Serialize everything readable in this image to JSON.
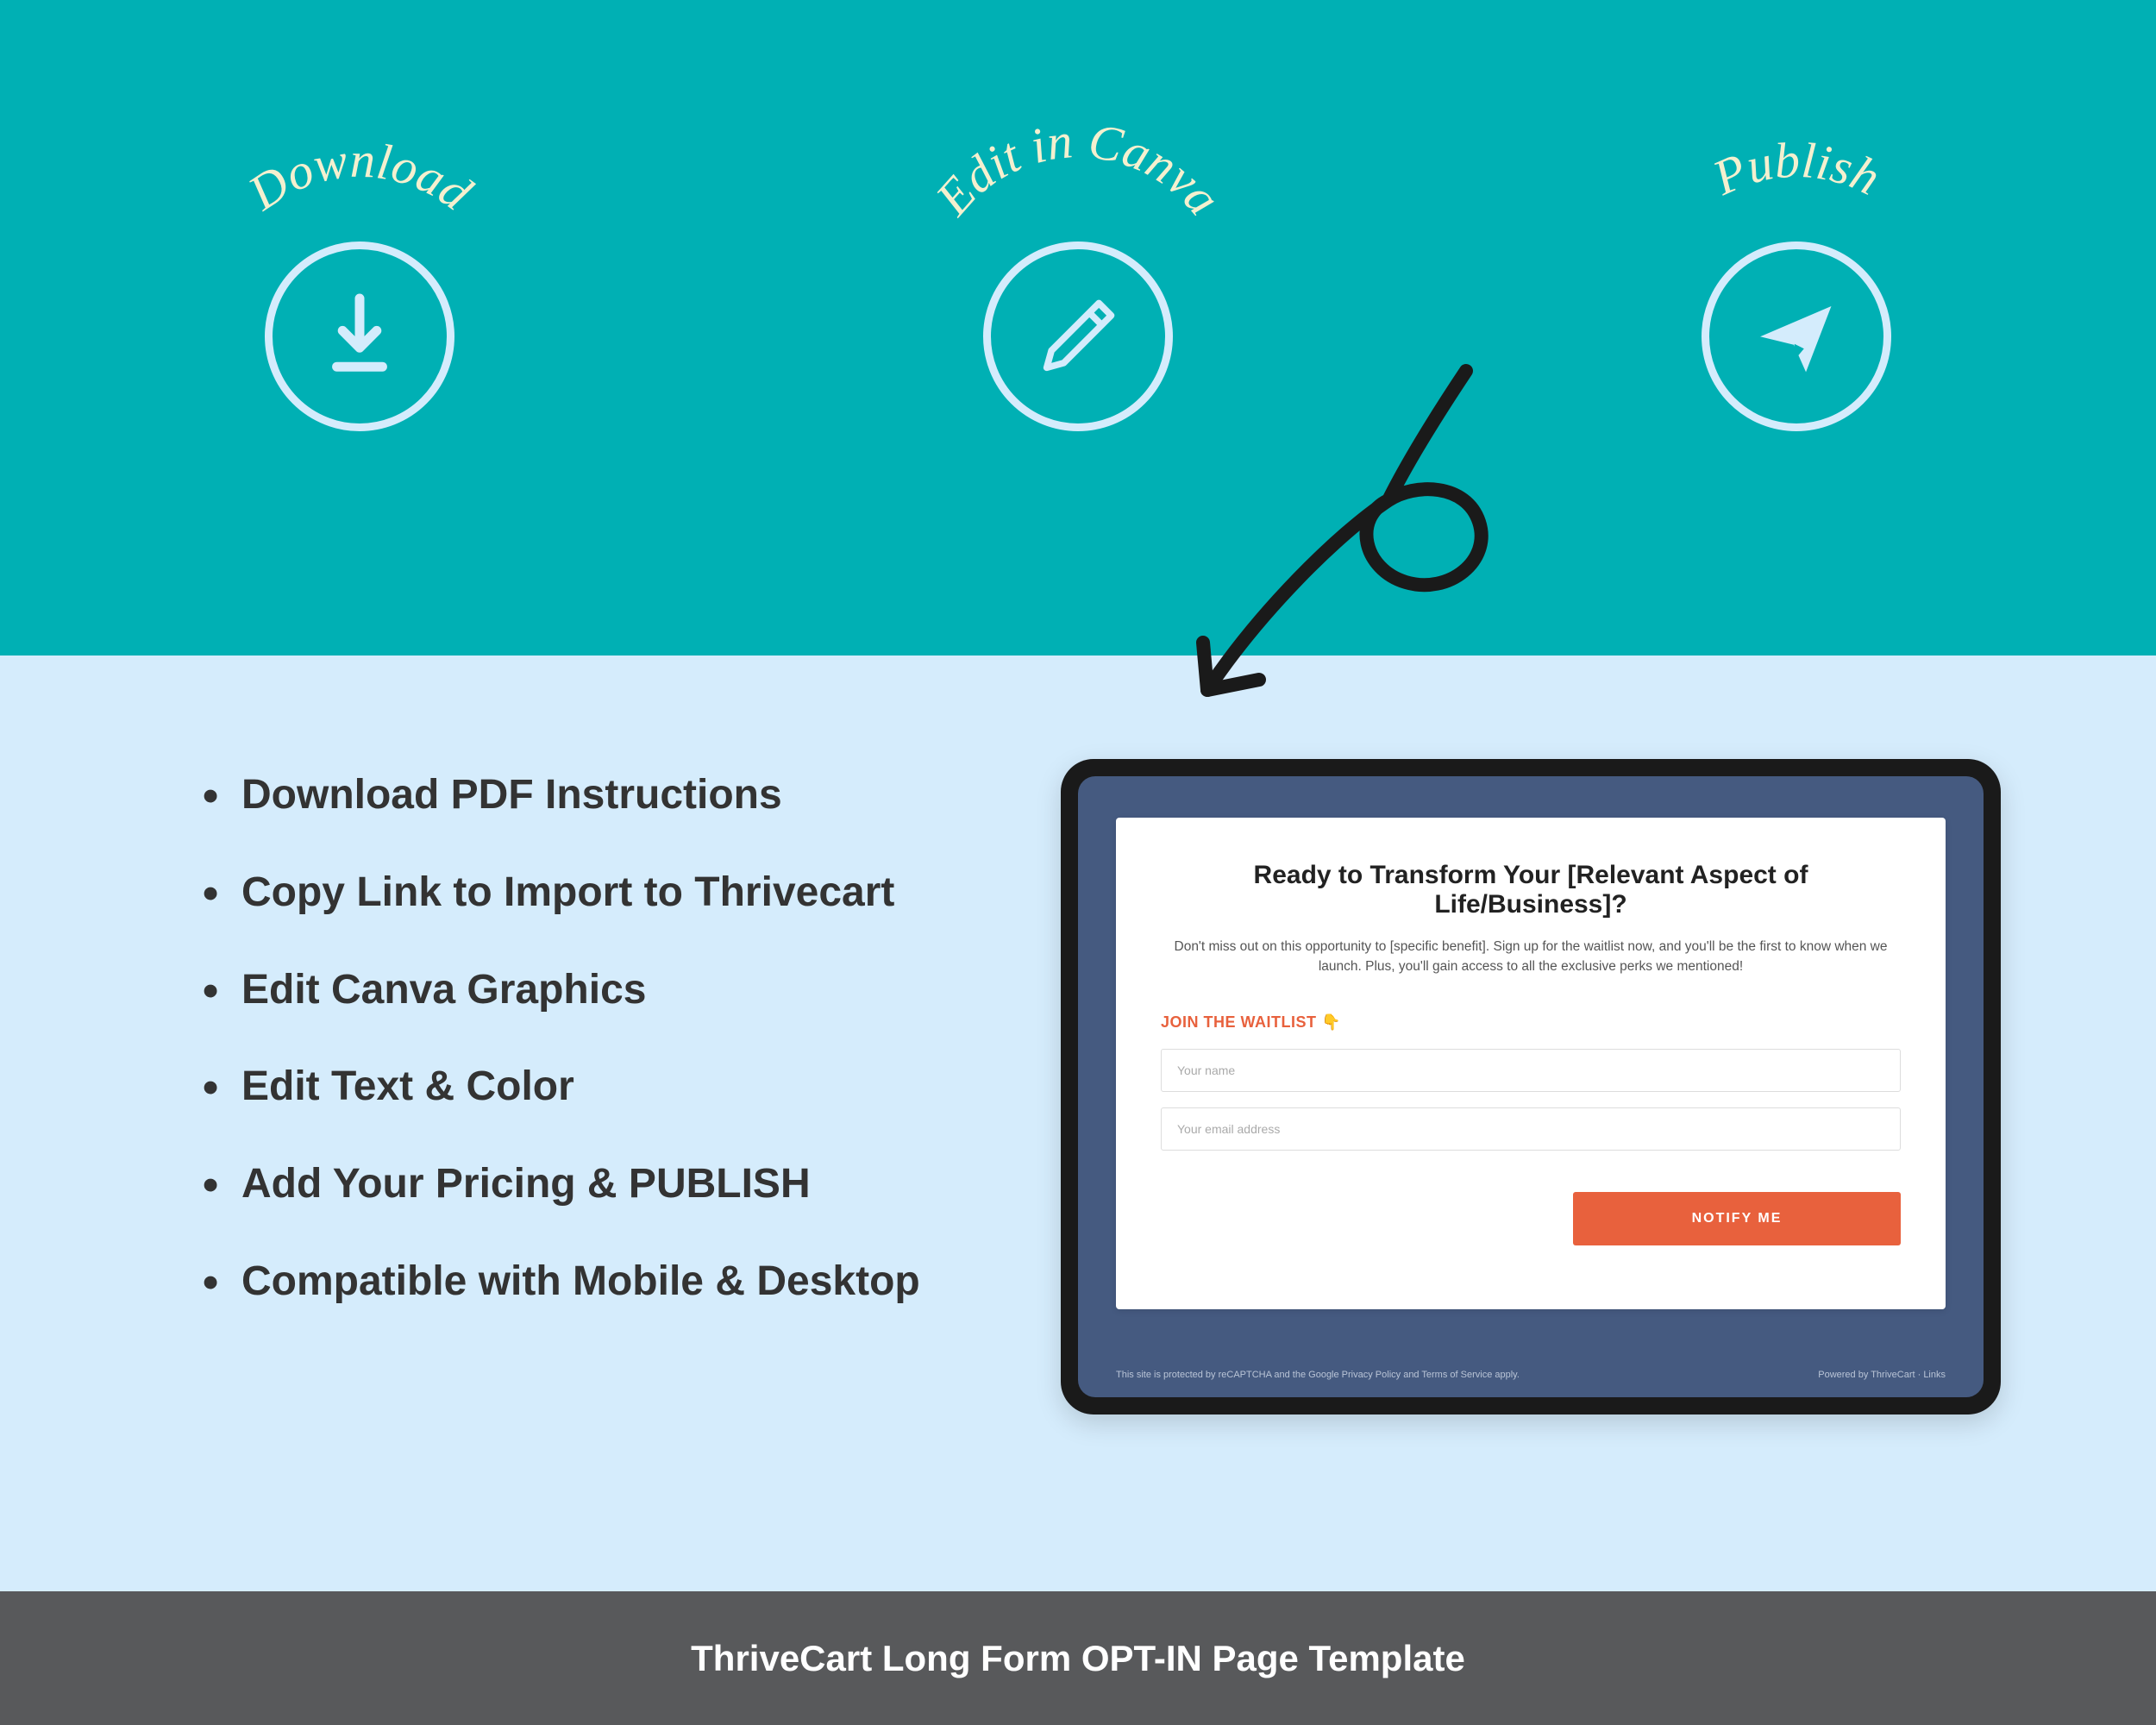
{
  "steps": {
    "download": {
      "label": "Download"
    },
    "edit": {
      "label": "Edit in Canva"
    },
    "publish": {
      "label": "Publish"
    }
  },
  "bullets": [
    "Download PDF Instructions",
    "Copy Link to Import to Thrivecart",
    "Edit Canva Graphics",
    "Edit Text & Color",
    "Add Your Pricing & PUBLISH",
    "Compatible with Mobile & Desktop"
  ],
  "tablet": {
    "title": "Ready to Transform Your [Relevant Aspect of Life/Business]?",
    "subtitle": "Don't miss out on this opportunity to [specific benefit]. Sign up for the waitlist now, and you'll be the first to know when we launch. Plus, you'll gain access to all the exclusive perks we mentioned!",
    "form_label": "JOIN THE WAITLIST 👇",
    "name_placeholder": "Your name",
    "email_placeholder": "Your email address",
    "button": "NOTIFY ME",
    "footer_left": "This site is protected by reCAPTCHA and the Google Privacy Policy and Terms of Service apply.",
    "footer_right": "Powered by ThriveCart · Links"
  },
  "footer": "ThriveCart Long Form OPT-IN Page Template"
}
